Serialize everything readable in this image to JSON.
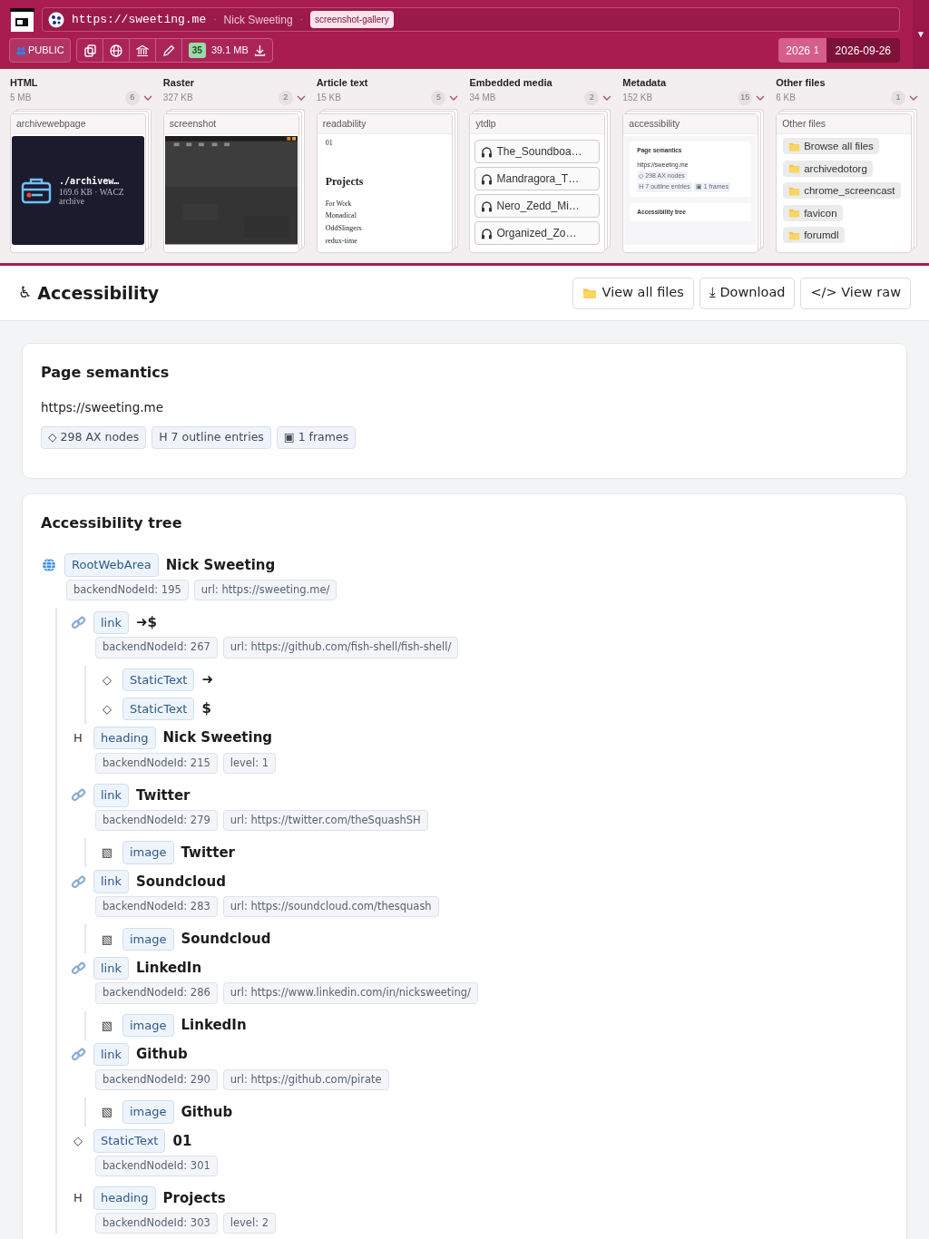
{
  "header": {
    "url": "https://sweeting.me",
    "separator": "·",
    "title": "Nick Sweeting",
    "separator2": "·",
    "tag": "screenshot-gallery",
    "visibility": "PUBLIC",
    "count": "35",
    "size": "39.1 MB",
    "year": "2026",
    "year_count": "1",
    "date": "2026-09-26",
    "menu": "▼"
  },
  "categories": [
    {
      "name": "HTML",
      "size": "5 MB",
      "count": "6",
      "card": {
        "title": "archivewebpage",
        "kind": "archive",
        "filename": "./archivew…",
        "meta": "169.6 KB · WACZ",
        "type": "archive"
      }
    },
    {
      "name": "Raster",
      "size": "327 KB",
      "count": "2",
      "card": {
        "title": "screenshot",
        "kind": "picture"
      }
    },
    {
      "name": "Article text",
      "size": "15 KB",
      "count": "5",
      "card": {
        "title": "readability",
        "kind": "article",
        "number": "01",
        "heading": "Projects",
        "subheading": "For Work",
        "links": [
          "Monadical",
          "OddSlingers",
          "redux-time"
        ]
      }
    },
    {
      "name": "Embedded media",
      "size": "34 MB",
      "count": "2",
      "card": {
        "title": "ytdlp",
        "kind": "media",
        "items": [
          "The_Soundboa…",
          "Mandragora_T…",
          "Nero_Zedd_Mi…",
          "Organized_Zo…"
        ]
      }
    },
    {
      "name": "Metadata",
      "size": "152 KB",
      "count": "15",
      "card": {
        "title": "accessibility",
        "kind": "mini",
        "heading": "Page semantics",
        "url": "https://sweeting.me",
        "chips": [
          "◇ 298 AX nodes",
          "H 7 outline entries",
          "▣ 1 frames"
        ],
        "heading2": "Accessibility tree"
      }
    },
    {
      "name": "Other files",
      "size": "6 KB",
      "count": "1",
      "card": {
        "title": "Other files",
        "kind": "files",
        "items": [
          "Browse all files",
          "archivedotorg",
          "chrome_screencast",
          "favicon",
          "forumdl"
        ]
      }
    }
  ],
  "panel": {
    "icon": "♿",
    "title": "Accessibility",
    "buttons": [
      {
        "kind": "folder",
        "label": "View all files"
      },
      {
        "kind": "plain",
        "label": "⤓ Download"
      },
      {
        "kind": "plain",
        "label": "</> View raw"
      }
    ]
  },
  "semantics": {
    "title": "Page semantics",
    "url": "https://sweeting.me",
    "chips": [
      "◇ 298 AX nodes",
      "H 7 outline entries",
      "▣ 1 frames"
    ]
  },
  "tree": {
    "title": "Accessibility tree",
    "nodes": [
      {
        "kind": "root",
        "role": "RootWebArea",
        "name": "Nick Sweeting",
        "props": [
          "backendNodeId: 195",
          "url: https://sweeting.me/"
        ],
        "children": [
          {
            "kind": "link",
            "role": "link",
            "name": "➜$",
            "props": [
              "backendNodeId: 267",
              "url: https://github.com/fish-shell/fish-shell/"
            ],
            "children": [
              {
                "kind": "text",
                "icon": "◇",
                "role": "StaticText",
                "name": "➜"
              },
              {
                "kind": "text",
                "icon": "◇",
                "role": "StaticText",
                "name": "$"
              }
            ]
          },
          {
            "kind": "text",
            "icon": "H",
            "role": "heading",
            "name": "Nick Sweeting",
            "props": [
              "backendNodeId: 215",
              "level: 1"
            ]
          },
          {
            "kind": "link",
            "role": "link",
            "name": "Twitter",
            "props": [
              "backendNodeId: 279",
              "url: https://twitter.com/theSquashSH"
            ],
            "children": [
              {
                "kind": "text",
                "icon": "▧",
                "role": "image",
                "name": "Twitter"
              }
            ]
          },
          {
            "kind": "link",
            "role": "link",
            "name": "Soundcloud",
            "props": [
              "backendNodeId: 283",
              "url: https://soundcloud.com/thesquash"
            ],
            "children": [
              {
                "kind": "text",
                "icon": "▧",
                "role": "image",
                "name": "Soundcloud"
              }
            ]
          },
          {
            "kind": "link",
            "role": "link",
            "name": "LinkedIn",
            "props": [
              "backendNodeId: 286",
              "url: https://www.linkedin.com/in/nicksweeting/"
            ],
            "children": [
              {
                "kind": "text",
                "icon": "▧",
                "role": "image",
                "name": "LinkedIn"
              }
            ]
          },
          {
            "kind": "link",
            "role": "link",
            "name": "Github",
            "props": [
              "backendNodeId: 290",
              "url: https://github.com/pirate"
            ],
            "children": [
              {
                "kind": "text",
                "icon": "▧",
                "role": "image",
                "name": "Github"
              }
            ]
          },
          {
            "kind": "text",
            "icon": "◇",
            "role": "StaticText",
            "name": "01",
            "props": [
              "backendNodeId: 301"
            ]
          },
          {
            "kind": "text",
            "icon": "H",
            "role": "heading",
            "name": "Projects",
            "props": [
              "backendNodeId: 303",
              "level: 2"
            ]
          }
        ]
      }
    ]
  }
}
